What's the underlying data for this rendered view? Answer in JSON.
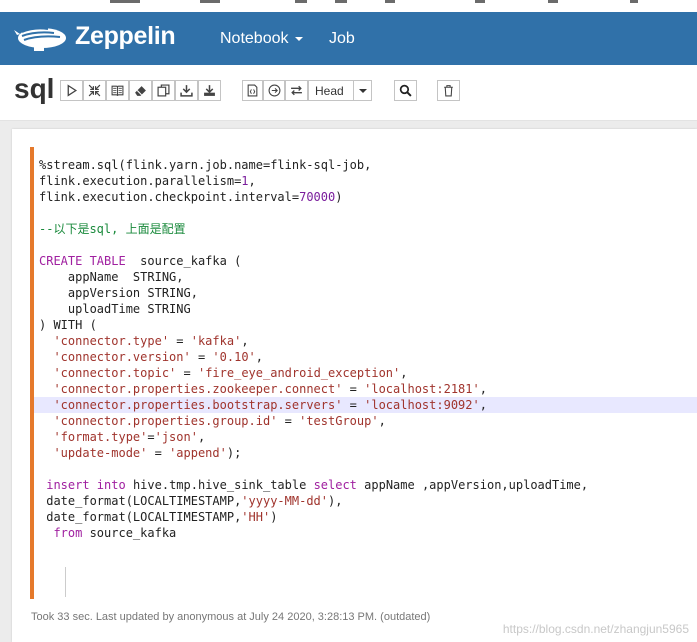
{
  "navbar": {
    "brand": "Zeppelin",
    "notebook_label": "Notebook",
    "job_label": "Job"
  },
  "toolbar": {
    "title": "sql",
    "head_label": "Head"
  },
  "editor": {
    "lines": [
      [
        {
          "t": "%stream.sql(flink.yarn.job.name=flink-sql-job,",
          "c": ""
        }
      ],
      [
        {
          "t": "flink.execution.parallelism=",
          "c": ""
        },
        {
          "t": "1",
          "c": "num"
        },
        {
          "t": ",",
          "c": ""
        }
      ],
      [
        {
          "t": "flink.execution.checkpoint.interval=",
          "c": ""
        },
        {
          "t": "70000",
          "c": "num"
        },
        {
          "t": ")",
          "c": ""
        }
      ],
      [],
      [
        {
          "t": "--以下是sql, 上面是配置",
          "c": "cmt"
        }
      ],
      [],
      [
        {
          "t": "CREATE TABLE",
          "c": "kw"
        },
        {
          "t": "  source_kafka (",
          "c": ""
        }
      ],
      [
        {
          "t": "    appName  STRING,",
          "c": ""
        }
      ],
      [
        {
          "t": "    appVersion STRING,",
          "c": ""
        }
      ],
      [
        {
          "t": "    uploadTime STRING",
          "c": ""
        }
      ],
      [
        {
          "t": ") WITH (",
          "c": ""
        }
      ],
      [
        {
          "t": "  ",
          "c": ""
        },
        {
          "t": "'connector.type'",
          "c": "str"
        },
        {
          "t": " = ",
          "c": ""
        },
        {
          "t": "'kafka'",
          "c": "str"
        },
        {
          "t": ",",
          "c": ""
        }
      ],
      [
        {
          "t": "  ",
          "c": ""
        },
        {
          "t": "'connector.version'",
          "c": "str"
        },
        {
          "t": " = ",
          "c": ""
        },
        {
          "t": "'0.10'",
          "c": "str"
        },
        {
          "t": ",",
          "c": ""
        }
      ],
      [
        {
          "t": "  ",
          "c": ""
        },
        {
          "t": "'connector.topic'",
          "c": "str"
        },
        {
          "t": " = ",
          "c": ""
        },
        {
          "t": "'fire_eye_android_exception'",
          "c": "str"
        },
        {
          "t": ",",
          "c": ""
        }
      ],
      [
        {
          "t": "  ",
          "c": ""
        },
        {
          "t": "'connector.properties.zookeeper.connect'",
          "c": "str"
        },
        {
          "t": " = ",
          "c": ""
        },
        {
          "t": "'localhost:2181'",
          "c": "str"
        },
        {
          "t": ",",
          "c": ""
        }
      ],
      [
        {
          "t": "  ",
          "c": ""
        },
        {
          "t": "'connector.properties.bootstrap.servers'",
          "c": "str"
        },
        {
          "t": " = ",
          "c": ""
        },
        {
          "t": "'localhost:9092'",
          "c": "str"
        },
        {
          "t": ",",
          "c": ""
        }
      ],
      [
        {
          "t": "  ",
          "c": ""
        },
        {
          "t": "'connector.properties.group.id'",
          "c": "str"
        },
        {
          "t": " = ",
          "c": ""
        },
        {
          "t": "'testGroup'",
          "c": "str"
        },
        {
          "t": ",",
          "c": ""
        }
      ],
      [
        {
          "t": "  ",
          "c": ""
        },
        {
          "t": "'format.type'",
          "c": "str"
        },
        {
          "t": "=",
          "c": ""
        },
        {
          "t": "'json'",
          "c": "str"
        },
        {
          "t": ",",
          "c": ""
        }
      ],
      [
        {
          "t": "  ",
          "c": ""
        },
        {
          "t": "'update-mode'",
          "c": "str"
        },
        {
          "t": " = ",
          "c": ""
        },
        {
          "t": "'append'",
          "c": "str"
        },
        {
          "t": ");",
          "c": ""
        }
      ],
      [],
      [
        {
          "t": " ",
          "c": ""
        },
        {
          "t": "insert into",
          "c": "kw"
        },
        {
          "t": " hive.tmp.hive_sink_table ",
          "c": ""
        },
        {
          "t": "select",
          "c": "kw"
        },
        {
          "t": " appName ,appVersion,uploadTime,",
          "c": ""
        }
      ],
      [
        {
          "t": " date_format(LOCALTIMESTAMP,",
          "c": ""
        },
        {
          "t": "'yyyy-MM-dd'",
          "c": "str"
        },
        {
          "t": "),",
          "c": ""
        }
      ],
      [
        {
          "t": " date_format(LOCALTIMESTAMP,",
          "c": ""
        },
        {
          "t": "'HH'",
          "c": "str"
        },
        {
          "t": ")",
          "c": ""
        }
      ],
      [
        {
          "t": "  ",
          "c": ""
        },
        {
          "t": "from",
          "c": "kw"
        },
        {
          "t": " source_kafka",
          "c": ""
        }
      ]
    ],
    "highlight_line": 15
  },
  "status_text": "Took 33 sec. Last updated by anonymous at July 24 2020, 3:28:13 PM. (outdated)",
  "watermark": "https://blog.csdn.net/zhangjun5965"
}
